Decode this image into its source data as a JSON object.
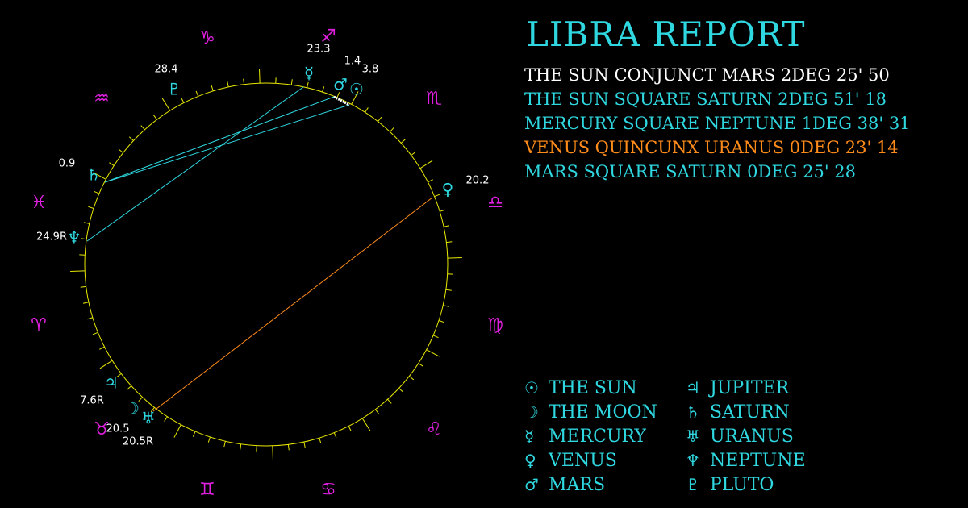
{
  "title": "LIBRA REPORT",
  "aspects": [
    {
      "text": "THE SUN CONJUNCT MARS 2DEG 25' 50",
      "color": "#ffffff"
    },
    {
      "text": "THE SUN SQUARE SATURN 2DEG 51' 18",
      "color": "#2fd8e0"
    },
    {
      "text": "MERCURY SQUARE NEPTUNE 1DEG 38' 31",
      "color": "#2fd8e0"
    },
    {
      "text": "VENUS QUINCUNX URANUS 0DEG 23' 14",
      "color": "#ff8c1a"
    },
    {
      "text": "MARS SQUARE SATURN 0DEG 25' 28",
      "color": "#2fd8e0"
    }
  ],
  "legend_left": [
    {
      "icon": "sun-icon",
      "glyph": "☉",
      "label": "THE SUN"
    },
    {
      "icon": "moon-icon",
      "glyph": "☽",
      "label": "THE MOON"
    },
    {
      "icon": "mercury-icon",
      "glyph": "☿",
      "label": "MERCURY"
    },
    {
      "icon": "venus-icon",
      "glyph": "♀",
      "label": "VENUS"
    },
    {
      "icon": "mars-icon",
      "glyph": "♂",
      "label": "MARS"
    }
  ],
  "legend_right": [
    {
      "icon": "jupiter-icon",
      "glyph": "♃",
      "label": "JUPITER"
    },
    {
      "icon": "saturn-icon",
      "glyph": "♄",
      "label": "SATURN"
    },
    {
      "icon": "uranus-icon",
      "glyph": "♅",
      "label": "URANUS"
    },
    {
      "icon": "neptune-icon",
      "glyph": "♆",
      "label": "NEPTUNE"
    },
    {
      "icon": "pluto-icon",
      "glyph": "♇",
      "label": "PLUTO"
    }
  ],
  "zodiac": [
    {
      "icon": "capricorn-icon",
      "glyph": "♑"
    },
    {
      "icon": "sagittarius-icon",
      "glyph": "♐"
    },
    {
      "icon": "scorpio-icon",
      "glyph": "♏"
    },
    {
      "icon": "libra-icon",
      "glyph": "♎"
    },
    {
      "icon": "virgo-icon",
      "glyph": "♍"
    },
    {
      "icon": "leo-icon",
      "glyph": "♌"
    },
    {
      "icon": "cancer-icon",
      "glyph": "♋"
    },
    {
      "icon": "gemini-icon",
      "glyph": "♊"
    },
    {
      "icon": "taurus-icon",
      "glyph": "♉"
    },
    {
      "icon": "aries-icon",
      "glyph": "♈"
    },
    {
      "icon": "pisces-icon",
      "glyph": "♓"
    },
    {
      "icon": "aquarius-icon",
      "glyph": "♒"
    }
  ],
  "planets": [
    {
      "icon": "pluto-icon",
      "glyph": "♇",
      "degree": "28.4"
    },
    {
      "icon": "mercury-icon",
      "glyph": "☿",
      "degree": "23.3"
    },
    {
      "icon": "mars-icon",
      "glyph": "♂",
      "degree": "1.4"
    },
    {
      "icon": "sun-icon",
      "glyph": "☉",
      "degree": "3.8"
    },
    {
      "icon": "venus-icon",
      "glyph": "♀",
      "degree": "20.2"
    },
    {
      "icon": "saturn-icon",
      "glyph": "♄",
      "degree": "0.9"
    },
    {
      "icon": "neptune-icon",
      "glyph": "♆",
      "degree": "24.9R"
    },
    {
      "icon": "jupiter-icon",
      "glyph": "♃",
      "degree": "7.6R"
    },
    {
      "icon": "moon-icon",
      "glyph": "☽",
      "degree": "20.5"
    },
    {
      "icon": "uranus-icon",
      "glyph": "♅",
      "degree": "20.5R"
    }
  ],
  "colors": {
    "background": "#000000",
    "accent": "#2fd8e0",
    "zodiac": "#e020e0",
    "wheel": "#e8e800",
    "orange": "#ff8c1a",
    "degree_text": "#ffffff"
  }
}
